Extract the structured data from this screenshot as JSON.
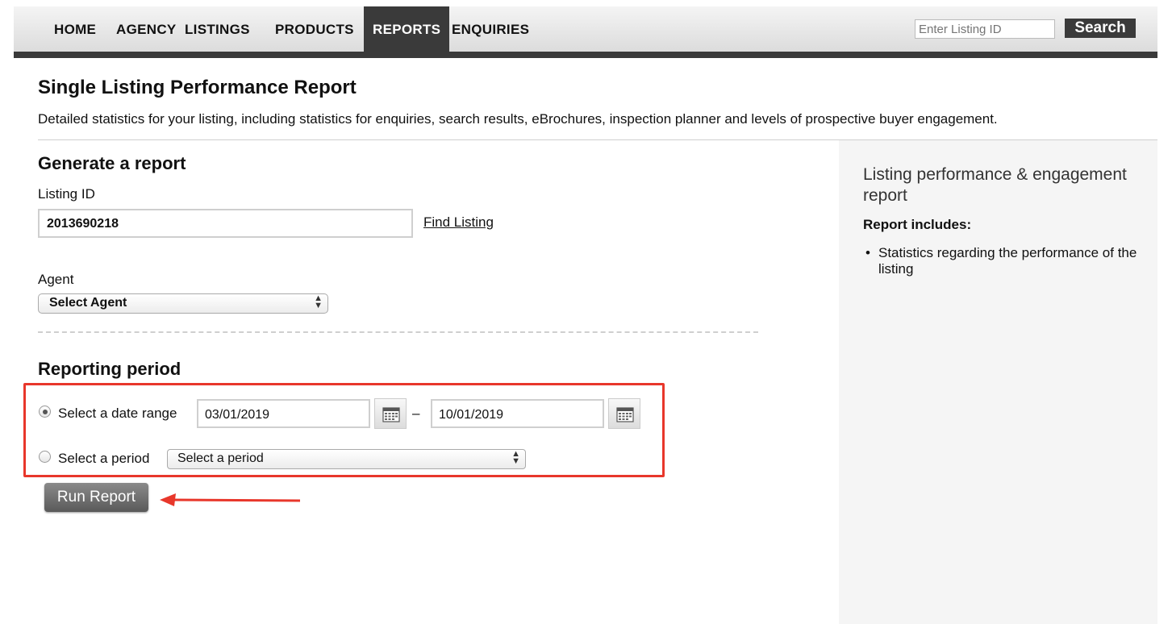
{
  "nav": {
    "items": [
      "HOME",
      "AGENCY",
      "LISTINGS",
      "PRODUCTS",
      "REPORTS",
      "ENQUIRIES"
    ],
    "active": "REPORTS",
    "search_placeholder": "Enter Listing ID",
    "search_label": "Search"
  },
  "page": {
    "title": "Single Listing Performance Report",
    "description": "Detailed statistics for your listing, including statistics for enquiries, search results, eBrochures, inspection planner and levels of prospective buyer engagement."
  },
  "generate": {
    "title": "Generate a report",
    "listing_label": "Listing ID",
    "listing_value": "2013690218",
    "find_link": "Find Listing",
    "agent_label": "Agent",
    "agent_value": "Select Agent"
  },
  "period": {
    "title": "Reporting period",
    "date_range_label": "Select a date range",
    "date_range_selected": true,
    "start_date": "03/01/2019",
    "separator": "–",
    "end_date": "10/01/2019",
    "period_label": "Select a period",
    "period_value": "Select a period"
  },
  "run_button": "Run Report",
  "sidebar": {
    "title": "Listing performance & engagement report",
    "subtitle": "Report includes:",
    "items": [
      "Statistics regarding the performance of the listing"
    ]
  },
  "colors": {
    "nav_dark": "#3a3a3a",
    "highlight": "#e8372b",
    "sidebar_bg": "#f5f5f5"
  }
}
